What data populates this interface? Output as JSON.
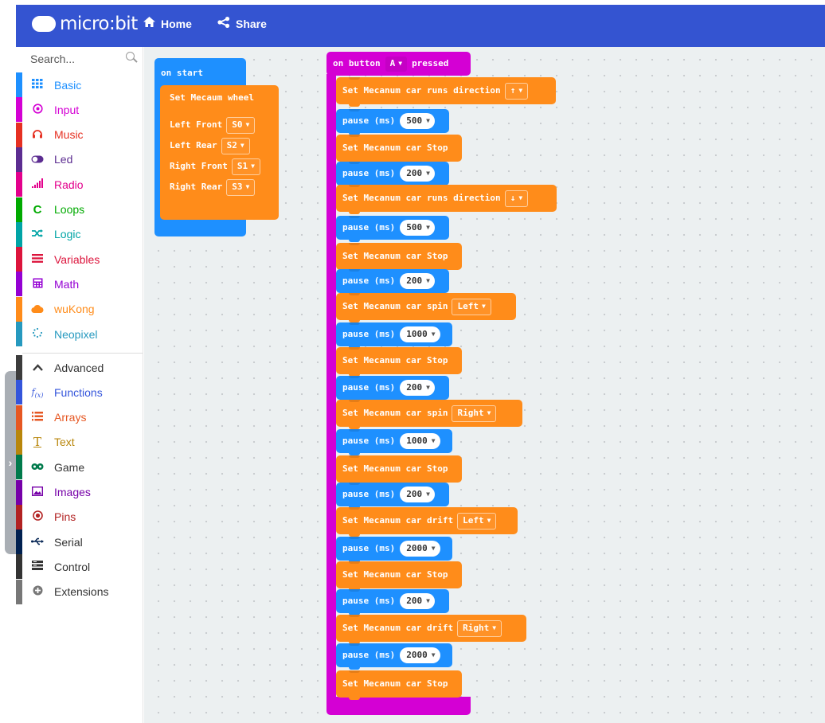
{
  "header": {
    "logo_text": "micro:bit",
    "home_label": "Home",
    "share_label": "Share"
  },
  "sidebar": {
    "search_placeholder": "Search...",
    "categories": [
      {
        "label": "Basic",
        "color": "#1E90FF",
        "icon": "grid-icon"
      },
      {
        "label": "Input",
        "color": "#D400D4",
        "icon": "target-icon"
      },
      {
        "label": "Music",
        "color": "#E63022",
        "icon": "headphones-icon"
      },
      {
        "label": "Led",
        "color": "#5C2D91",
        "icon": "toggle-icon"
      },
      {
        "label": "Radio",
        "color": "#E3008C",
        "icon": "signal-icon"
      },
      {
        "label": "Loops",
        "color": "#00AA00",
        "icon": "loop-icon"
      },
      {
        "label": "Logic",
        "color": "#00A4A6",
        "icon": "shuffle-icon"
      },
      {
        "label": "Variables",
        "color": "#DC143C",
        "icon": "lines-icon"
      },
      {
        "label": "Math",
        "color": "#9400D3",
        "icon": "calculator-icon"
      },
      {
        "label": "wuKong",
        "color": "#FF8C1A",
        "icon": "cloud-icon"
      },
      {
        "label": "Neopixel",
        "color": "#2699BF",
        "icon": "dots-circle-icon"
      }
    ],
    "advanced_categories": [
      {
        "label": "Advanced",
        "color": "#3c3c3c",
        "icon": "chevron-up-icon"
      },
      {
        "label": "Functions",
        "color": "#3455DB",
        "icon": "function-icon"
      },
      {
        "label": "Arrays",
        "color": "#E65722",
        "icon": "list-icon"
      },
      {
        "label": "Text",
        "color": "#B8860B",
        "icon": "text-icon"
      },
      {
        "label": "Game",
        "color": "#007A4B",
        "icon": "gamepad-icon"
      },
      {
        "label": "Images",
        "color": "#7600A8",
        "icon": "image-icon"
      },
      {
        "label": "Pins",
        "color": "#B22222",
        "icon": "pin-icon"
      },
      {
        "label": "Serial",
        "color": "#002050",
        "icon": "usb-icon"
      },
      {
        "label": "Control",
        "color": "#333333",
        "icon": "control-icon"
      },
      {
        "label": "Extensions",
        "color": "#777777",
        "icon": "plus-circle-icon"
      }
    ]
  },
  "on_start": {
    "header": "on start",
    "title": "Set Mecaum wheel",
    "rows": [
      {
        "label": "Left Front",
        "value": "S0"
      },
      {
        "label": "Left Rear",
        "value": "S2"
      },
      {
        "label": "Right Front",
        "value": "S1"
      },
      {
        "label": "Right Rear",
        "value": "S3"
      }
    ]
  },
  "on_button": {
    "prefix": "on button",
    "button": "A",
    "suffix": "pressed",
    "blocks": [
      {
        "type": "cmd",
        "text": "Set Mecanum car runs direction",
        "dd": "↑"
      },
      {
        "type": "pause",
        "text": "pause (ms)",
        "value": "500"
      },
      {
        "type": "cmd",
        "text": "Set Mecanum car Stop"
      },
      {
        "type": "pause",
        "text": "pause (ms)",
        "value": "200"
      },
      {
        "type": "cmd",
        "text": "Set Mecanum car runs direction",
        "dd": "↓"
      },
      {
        "type": "pause",
        "text": "pause (ms)",
        "value": "500"
      },
      {
        "type": "cmd",
        "text": "Set Mecanum car Stop"
      },
      {
        "type": "pause",
        "text": "pause (ms)",
        "value": "200"
      },
      {
        "type": "cmd",
        "text": "Set Mecanum car spin",
        "dd": "Left"
      },
      {
        "type": "pause",
        "text": "pause (ms)",
        "value": "1000"
      },
      {
        "type": "cmd",
        "text": "Set Mecanum car Stop"
      },
      {
        "type": "pause",
        "text": "pause (ms)",
        "value": "200"
      },
      {
        "type": "cmd",
        "text": "Set Mecanum car spin",
        "dd": "Right"
      },
      {
        "type": "pause",
        "text": "pause (ms)",
        "value": "1000"
      },
      {
        "type": "cmd",
        "text": "Set Mecanum car Stop"
      },
      {
        "type": "pause",
        "text": "pause (ms)",
        "value": "200"
      },
      {
        "type": "cmd",
        "text": "Set Mecanum car drift",
        "dd": "Left"
      },
      {
        "type": "pause",
        "text": "pause (ms)",
        "value": "2000"
      },
      {
        "type": "cmd",
        "text": "Set Mecanum car Stop"
      },
      {
        "type": "pause",
        "text": "pause (ms)",
        "value": "200"
      },
      {
        "type": "cmd",
        "text": "Set Mecanum car drift",
        "dd": "Right"
      },
      {
        "type": "pause",
        "text": "pause (ms)",
        "value": "2000"
      },
      {
        "type": "cmd",
        "text": "Set Mecanum car Stop"
      }
    ]
  }
}
